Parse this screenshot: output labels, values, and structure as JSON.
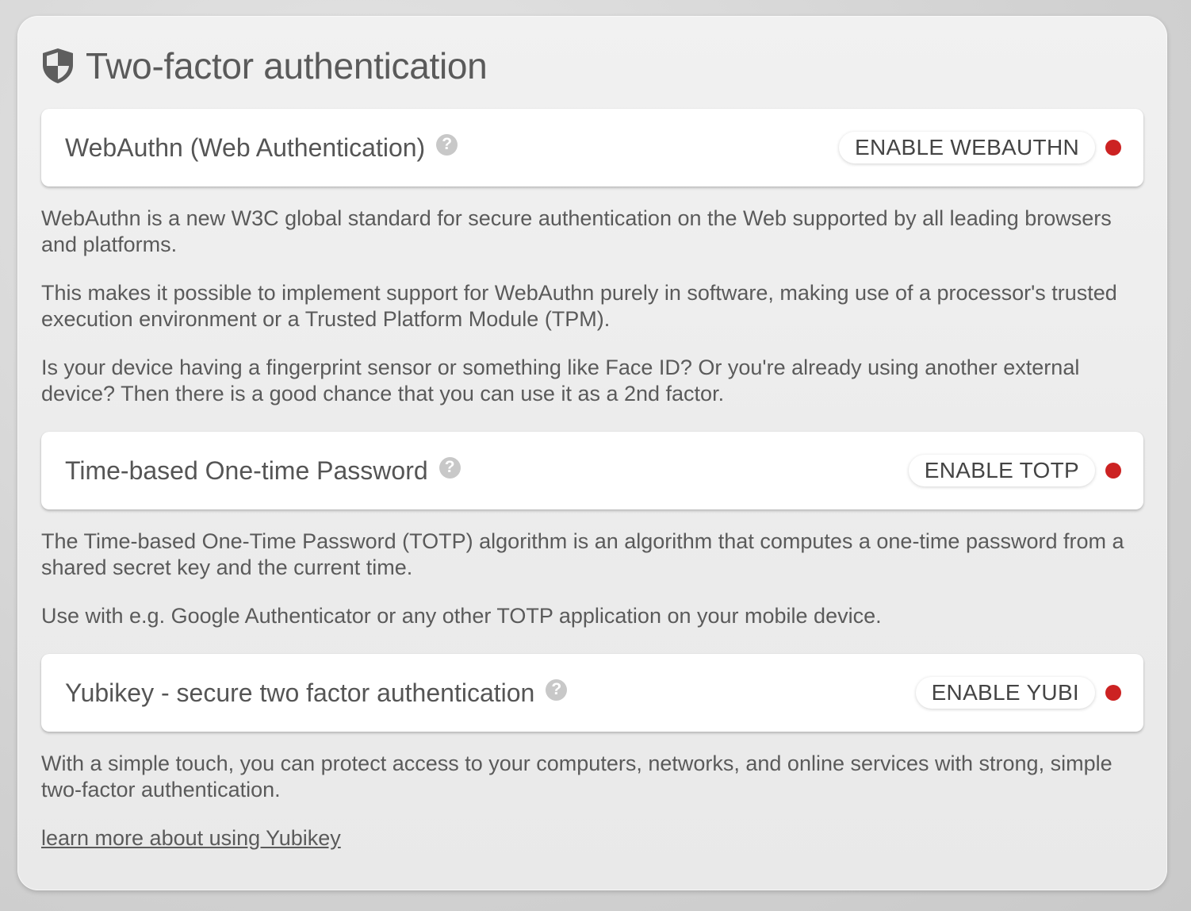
{
  "panel": {
    "title": "Two-factor authentication",
    "icon": "shield-icon"
  },
  "sections": [
    {
      "title": "WebAuthn (Web Authentication)",
      "button_label": "ENABLE WEBAUTHN",
      "help_glyph": "?",
      "status_color": "#cc2222",
      "paragraphs": [
        "WebAuthn is a new W3C global standard for secure authentication on the Web supported by all leading browsers and platforms.",
        "This makes it possible to implement support for WebAuthn purely in software, making use of a processor's trusted execution environment or a Trusted Platform Module (TPM).",
        "Is your device having a fingerprint sensor or something like Face ID? Or you're already using another external device? Then there is a good chance that you can use it as a 2nd factor."
      ]
    },
    {
      "title": "Time-based One-time Password",
      "button_label": "ENABLE TOTP",
      "help_glyph": "?",
      "status_color": "#cc2222",
      "paragraphs": [
        "The Time-based One-Time Password (TOTP) algorithm is an algorithm that computes a one-time password from a shared secret key and the current time.",
        "Use with e.g. Google Authenticator or any other TOTP application on your mobile device."
      ]
    },
    {
      "title": "Yubikey - secure two factor authentication",
      "button_label": "ENABLE YUBI",
      "help_glyph": "?",
      "status_color": "#cc2222",
      "paragraphs": [
        "With a simple touch, you can protect access to your computers, networks, and online services with strong, simple two-factor authentication."
      ],
      "link_text": "learn more about using Yubikey"
    }
  ]
}
